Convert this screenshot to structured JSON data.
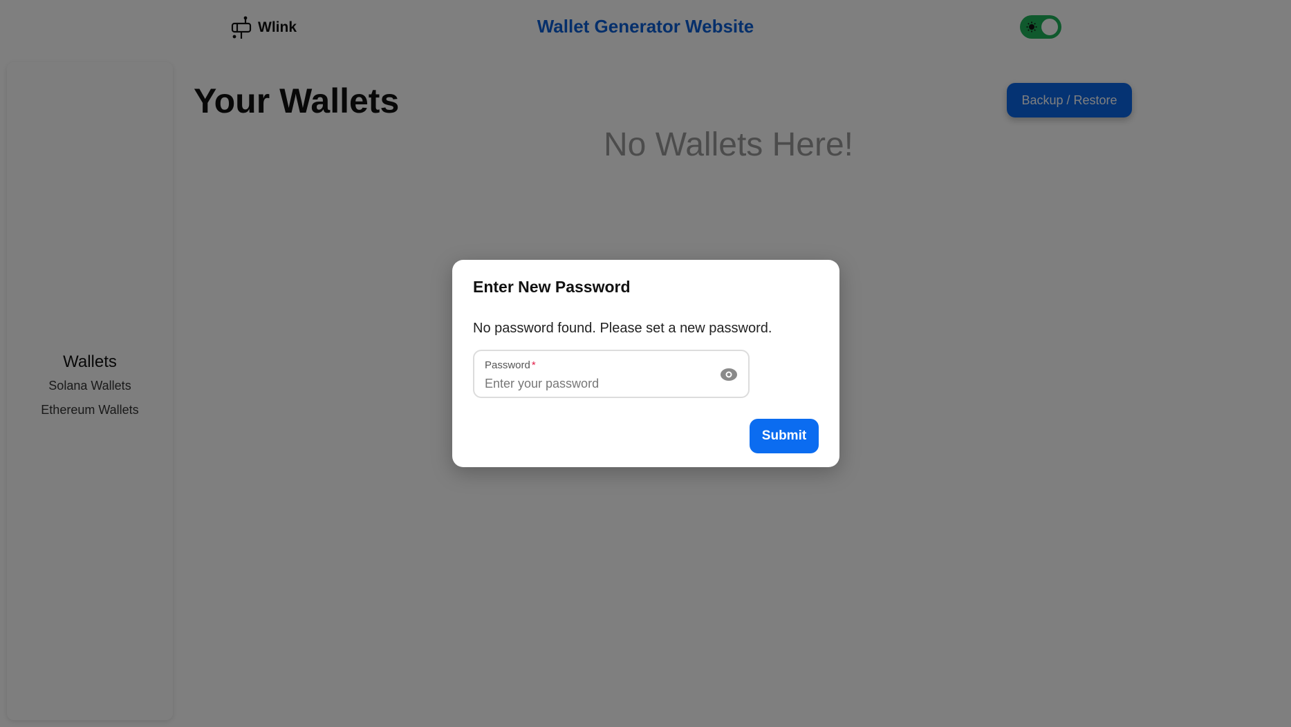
{
  "header": {
    "brand_name": "Wlink",
    "brand_icon": "mailbox-icon",
    "site_title": "Wallet Generator Website",
    "theme_toggle": {
      "icon": "sun-icon",
      "state": "on",
      "color": "#1fb35a"
    }
  },
  "sidebar": {
    "title": "Wallets",
    "items": [
      {
        "label": "Solana Wallets"
      },
      {
        "label": "Ethereum Wallets"
      }
    ]
  },
  "main": {
    "title": "Your Wallets",
    "backup_button": "Backup / Restore",
    "empty_message": "No Wallets Here!"
  },
  "modal": {
    "title": "Enter New Password",
    "message": "No password found. Please set a new password.",
    "password_field": {
      "label": "Password",
      "required_mark": "*",
      "placeholder": "Enter your password",
      "value": ""
    },
    "toggle_visibility_icon": "eye-icon",
    "submit_label": "Submit"
  },
  "colors": {
    "accent": "#0b6cf0",
    "title_blue": "#0a5fd6",
    "required_red": "#e11d48"
  }
}
